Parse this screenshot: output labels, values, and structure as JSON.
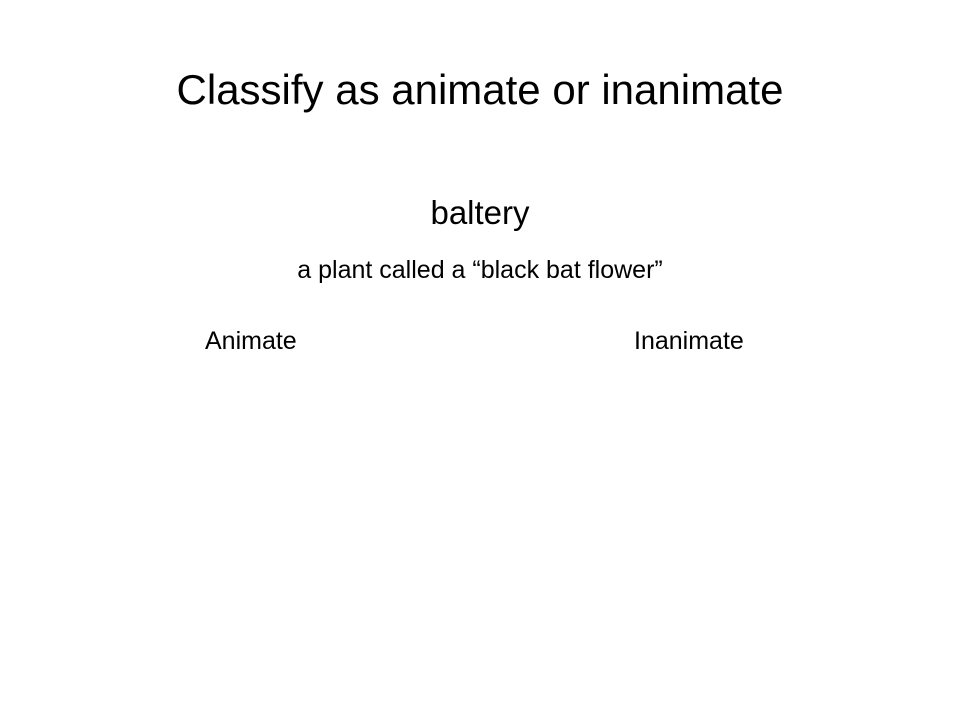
{
  "slide": {
    "title": "Classify as animate or inanimate",
    "word": "baltery",
    "definition": "a plant called a “black bat flower”",
    "options": [
      "Animate",
      "Inanimate"
    ]
  }
}
